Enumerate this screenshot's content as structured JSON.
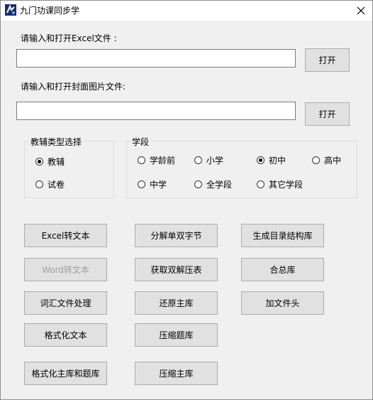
{
  "window": {
    "title": "九门功课同步学"
  },
  "excel": {
    "label": "请输入和打开Excel文件 :",
    "value": "",
    "open_label": "打开"
  },
  "cover": {
    "label": "请输入和打开封面图片文件:",
    "value": "",
    "open_label": "打开"
  },
  "type_group": {
    "title": "教辅类型选择",
    "options": [
      {
        "label": "教辅",
        "checked": true
      },
      {
        "label": "试卷",
        "checked": false
      }
    ]
  },
  "stage_group": {
    "title": "学段",
    "options": [
      {
        "label": "学龄前",
        "checked": false
      },
      {
        "label": "小学",
        "checked": false
      },
      {
        "label": "初中",
        "checked": true
      },
      {
        "label": "高中",
        "checked": false
      },
      {
        "label": "中学",
        "checked": false
      },
      {
        "label": "全学段",
        "checked": false
      },
      {
        "label": "其它学段",
        "checked": false
      }
    ]
  },
  "buttons": {
    "excel_to_text": "Excel转文本",
    "split_single_double": "分解单双字节",
    "gen_toc_lib": "生成目录结构库",
    "word_to_text": "Word转文本",
    "get_double_unzip": "获取双解压表",
    "merge_lib": "合总库",
    "vocab_process": "词汇文件处理",
    "restore_main": "还原主库",
    "add_header": "加文件头",
    "format_text": "格式化文本",
    "compress_questions": "压缩题库",
    "format_main_and_questions": "格式化主库和题库",
    "compress_main": "压缩主库"
  }
}
